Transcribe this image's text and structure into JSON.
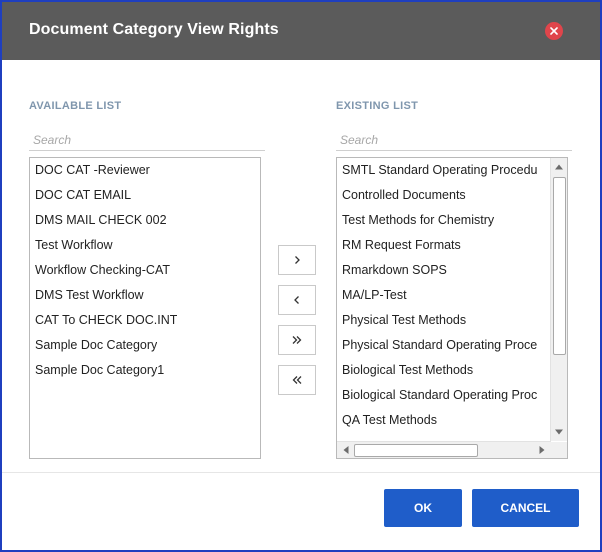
{
  "dialog": {
    "title": "Document Category View Rights"
  },
  "available": {
    "label": "AVAILABLE LIST",
    "search_placeholder": "Search",
    "items": [
      "DOC CAT -Reviewer",
      "DOC CAT EMAIL",
      "DMS MAIL CHECK 002",
      "Test Workflow",
      "Workflow Checking-CAT",
      "DMS Test Workflow",
      "CAT To CHECK DOC.INT",
      "Sample Doc Category",
      "Sample Doc Category1"
    ]
  },
  "existing": {
    "label": "EXISTING LIST",
    "search_placeholder": "Search",
    "items": [
      "SMTL Standard Operating Procedu",
      "Controlled Documents",
      "Test Methods for Chemistry",
      "RM Request Formats",
      "Rmarkdown SOPS",
      "MA/LP-Test",
      "Physical Test Methods",
      "Physical Standard Operating Proce",
      "Biological Test Methods",
      "Biological Standard Operating Proc",
      "QA Test Methods"
    ]
  },
  "transfer_buttons": {
    "move_right": "›",
    "move_left": "‹",
    "move_all_right": "»",
    "move_all_left": "«"
  },
  "footer": {
    "ok_label": "OK",
    "cancel_label": "CANCEL"
  },
  "colors": {
    "header_bg": "#5b5b5b",
    "close_red": "#e0454b",
    "primary_button": "#1f5dc9",
    "section_label": "#7f96ad",
    "dialog_border": "#1f3fbf"
  },
  "icons": {
    "close": "close-x-icon",
    "scroll_up": "triangle-up-icon",
    "scroll_down": "triangle-down-icon",
    "scroll_left": "triangle-left-icon",
    "scroll_right": "triangle-right-icon"
  }
}
